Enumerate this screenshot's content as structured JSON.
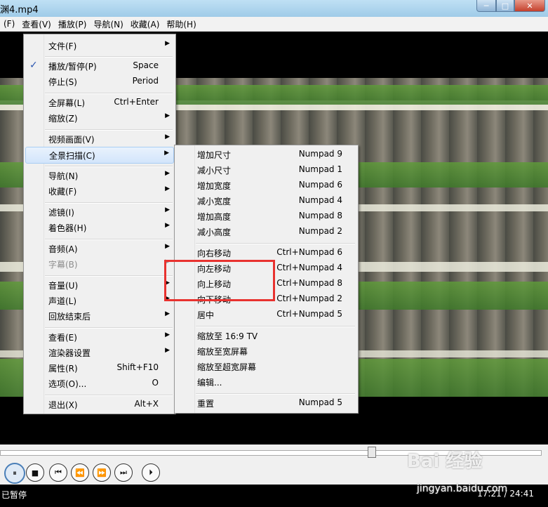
{
  "window": {
    "title": "渊4.mp4",
    "buttons": {
      "minimize": "─",
      "maximize": "□",
      "close": "✕"
    }
  },
  "menubar": [
    "(F)",
    "查看(V)",
    "播放(P)",
    "导航(N)",
    "收藏(A)",
    "帮助(H)"
  ],
  "context_menu": {
    "items": [
      {
        "label": "文件(F)",
        "arrow": "▶"
      },
      {
        "label": "播放/暂停(P)",
        "shortcut": "Space",
        "checked": "✓"
      },
      {
        "label": "停止(S)",
        "shortcut": "Period"
      },
      {
        "label": "全屏幕(L)",
        "shortcut": "Ctrl+Enter"
      },
      {
        "label": "缩放(Z)",
        "arrow": "▶"
      },
      {
        "label": "视频画面(V)",
        "arrow": "▶"
      },
      {
        "label": "全景扫描(C)",
        "arrow": "▶"
      },
      {
        "label": "导航(N)",
        "arrow": "▶"
      },
      {
        "label": "收藏(F)",
        "arrow": "▶"
      },
      {
        "label": "滤镜(I)",
        "arrow": "▶"
      },
      {
        "label": "着色器(H)",
        "arrow": "▶"
      },
      {
        "label": "音频(A)",
        "arrow": "▶"
      },
      {
        "label": "字幕(B)",
        "arrow": "▶"
      },
      {
        "label": "音量(U)",
        "arrow": "▶"
      },
      {
        "label": "声道(L)",
        "arrow": "▶"
      },
      {
        "label": "回放结束后",
        "arrow": "▶"
      },
      {
        "label": "查看(E)",
        "arrow": "▶"
      },
      {
        "label": "渲染器设置",
        "arrow": "▶"
      },
      {
        "label": "属性(R)",
        "shortcut": "Shift+F10"
      },
      {
        "label": "选项(O)...",
        "shortcut": "O"
      },
      {
        "label": "退出(X)",
        "shortcut": "Alt+X"
      }
    ]
  },
  "submenu": {
    "items": [
      {
        "label": "增加尺寸",
        "shortcut": "Numpad 9"
      },
      {
        "label": "减小尺寸",
        "shortcut": "Numpad 1"
      },
      {
        "label": "增加宽度",
        "shortcut": "Numpad 6"
      },
      {
        "label": "减小宽度",
        "shortcut": "Numpad 4"
      },
      {
        "label": "增加高度",
        "shortcut": "Numpad 8"
      },
      {
        "label": "减小高度",
        "shortcut": "Numpad 2"
      },
      {
        "label": "向右移动",
        "shortcut": "Ctrl+Numpad 6"
      },
      {
        "label": "向左移动",
        "shortcut": "Ctrl+Numpad 4"
      },
      {
        "label": "向上移动",
        "shortcut": "Ctrl+Numpad 8"
      },
      {
        "label": "向下移动",
        "shortcut": "Ctrl+Numpad 2"
      },
      {
        "label": "居中",
        "shortcut": "Ctrl+Numpad 5"
      },
      {
        "label": "缩放至 16:9 TV"
      },
      {
        "label": "缩放至宽屏幕"
      },
      {
        "label": "缩放至超宽屏幕"
      },
      {
        "label": "编辑..."
      },
      {
        "label": "重置",
        "shortcut": "Numpad 5"
      }
    ]
  },
  "controls": {
    "play_pause": "⏸",
    "stop": "■",
    "prev": "⏮",
    "rewind": "⏪",
    "forward": "⏩",
    "next": "⏭",
    "frame_step": "⏵",
    "seek_fraction": 0.68
  },
  "status": {
    "state": "已暂停",
    "time": "17:21 / 24:41"
  },
  "watermark": {
    "main": "Bai 经验",
    "sub": "jingyan.baidu.com"
  },
  "colors": {
    "highlight_box": "#e8322f",
    "menu_bg": "#f0f0f0",
    "selected_bg": "#d3e5fb"
  }
}
